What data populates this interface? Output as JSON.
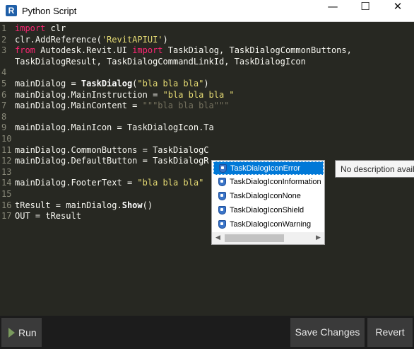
{
  "window": {
    "app_icon_letter": "R",
    "title": "Python Script",
    "minimize_glyph": "—",
    "maximize_glyph": "☐",
    "close_glyph": "✕"
  },
  "editor": {
    "line_numbers": [
      "1",
      "2",
      "3",
      "4",
      "5",
      "6",
      "7",
      "8",
      "9",
      "10",
      "11",
      "12",
      "13",
      "14",
      "15",
      "16",
      "17"
    ],
    "lines": [
      [
        {
          "t": "import",
          "c": "kw"
        },
        {
          "t": " clr",
          "c": ""
        }
      ],
      [
        {
          "t": "clr.AddReference(",
          "c": ""
        },
        {
          "t": "'RevitAPIUI'",
          "c": "str"
        },
        {
          "t": ")",
          "c": ""
        }
      ],
      [
        {
          "t": "from",
          "c": "kw"
        },
        {
          "t": " Autodesk.Revit.UI ",
          "c": ""
        },
        {
          "t": "import",
          "c": "kw"
        },
        {
          "t": " TaskDialog, TaskDialogCommonButtons,",
          "c": ""
        }
      ],
      [
        {
          "t": "TaskDialogResult, TaskDialogCommandLinkId, TaskDialogIcon",
          "c": ""
        }
      ],
      [],
      [
        {
          "t": "mainDialog = ",
          "c": ""
        },
        {
          "t": "TaskDialog",
          "c": "fn"
        },
        {
          "t": "(",
          "c": ""
        },
        {
          "t": "\"bla bla bla\"",
          "c": "str"
        },
        {
          "t": ")",
          "c": ""
        }
      ],
      [
        {
          "t": "mainDialog.MainInstruction = ",
          "c": ""
        },
        {
          "t": "\"bla bla bla \"",
          "c": "str"
        }
      ],
      [
        {
          "t": "mainDialog.MainContent = ",
          "c": ""
        },
        {
          "t": "\"\"\"bla bla bla\"\"\"",
          "c": "doc"
        }
      ],
      [],
      [
        {
          "t": "mainDialog.MainIcon = TaskDialogIcon.Ta",
          "c": ""
        }
      ],
      [],
      [
        {
          "t": "mainDialog.CommonButtons = TaskDialogC",
          "c": ""
        }
      ],
      [
        {
          "t": "mainDialog.DefaultButton = TaskDialogR",
          "c": ""
        }
      ],
      [],
      [
        {
          "t": "mainDialog.FooterText = ",
          "c": ""
        },
        {
          "t": "\"bla bla bla\"",
          "c": "str"
        }
      ],
      [],
      [
        {
          "t": "tResult = mainDialog.",
          "c": ""
        },
        {
          "t": "Show",
          "c": "fn"
        },
        {
          "t": "()",
          "c": ""
        }
      ],
      [
        {
          "t": "OUT = tResult",
          "c": ""
        }
      ]
    ]
  },
  "autocomplete": {
    "items": [
      "TaskDialogIconError",
      "TaskDialogIconInformation",
      "TaskDialogIconNone",
      "TaskDialogIconShield",
      "TaskDialogIconWarning"
    ],
    "selected_index": 0,
    "scroll_left_glyph": "◀",
    "scroll_right_glyph": "▶"
  },
  "tooltip": {
    "text": "No description available"
  },
  "bottom_bar": {
    "run_label": "Run",
    "save_label": "Save Changes",
    "revert_label": "Revert"
  }
}
